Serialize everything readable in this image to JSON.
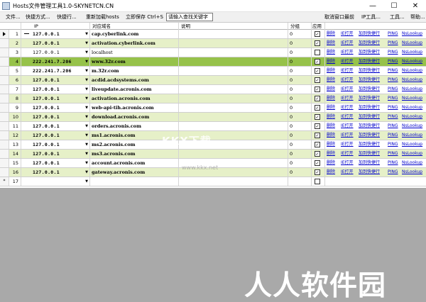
{
  "window": {
    "title": "Hosts文件管理工具1.0-SKYNETCN.CN"
  },
  "menu": {
    "file": "文件...",
    "quick_method": "快捷方式...",
    "quick_run": "快捷行...",
    "reload": "重新加载hosts",
    "save": "立即保存 Ctrl+S",
    "search_placeholder": "请输入查找关键字",
    "cancel_top": "取消窗口最前",
    "ip_tools": "IP工具...",
    "tools": "工具...",
    "help": "帮助..."
  },
  "columns": {
    "ip": "IP",
    "domain": "对应域名",
    "desc": "说明",
    "group": "分组",
    "apply": "应用"
  },
  "links": {
    "delete": "删除",
    "open": "IE打开",
    "add_quick": "加到快捷行",
    "ping": "PING",
    "nslookup": "NsLookup"
  },
  "rows": [
    {
      "num": "1",
      "ip": "127.0.0.1",
      "domain": "cap.cyberlink.com",
      "group": "0",
      "checked": "✓"
    },
    {
      "num": "2",
      "ip": "127.0.0.1",
      "domain": "activation.cyberlink.com",
      "group": "0",
      "checked": "✓"
    },
    {
      "num": "3",
      "ip": "127.0.0.1",
      "domain": "localhost",
      "group": "0",
      "checked": ""
    },
    {
      "num": "4",
      "ip": "222.241.7.206",
      "domain": "www.32r.com",
      "group": "0",
      "checked": "✓"
    },
    {
      "num": "5",
      "ip": "222.241.7.206",
      "domain": "m.32r.com",
      "group": "0",
      "checked": "✓"
    },
    {
      "num": "6",
      "ip": "127.0.0.1",
      "domain": "acdid.acdsystems.com",
      "group": "0",
      "checked": "✓"
    },
    {
      "num": "7",
      "ip": "127.0.0.1",
      "domain": "liveupdate.acronis.com",
      "group": "0",
      "checked": "✓"
    },
    {
      "num": "8",
      "ip": "127.0.0.1",
      "domain": "activation.acronis.com",
      "group": "0",
      "checked": "✓"
    },
    {
      "num": "9",
      "ip": "127.0.0.1",
      "domain": "web-api-tih.acronis.com",
      "group": "0",
      "checked": "✓"
    },
    {
      "num": "10",
      "ip": "127.0.0.1",
      "domain": "download.acronis.com",
      "group": "0",
      "checked": "✓"
    },
    {
      "num": "11",
      "ip": "127.0.0.1",
      "domain": "orders.acronis.com",
      "group": "0",
      "checked": "✓"
    },
    {
      "num": "12",
      "ip": "127.0.0.1",
      "domain": "ms1.acronis.com",
      "group": "0",
      "checked": "✓"
    },
    {
      "num": "13",
      "ip": "127.0.0.1",
      "domain": "ms2.acronis.com",
      "group": "0",
      "checked": "✓"
    },
    {
      "num": "14",
      "ip": "127.0.0.1",
      "domain": "ms3.acronis.com",
      "group": "0",
      "checked": "✓"
    },
    {
      "num": "15",
      "ip": "127.0.0.1",
      "domain": "account.acronis.com",
      "group": "0",
      "checked": "✓"
    },
    {
      "num": "16",
      "ip": "127.0.0.1",
      "domain": "gateway.acronis.com",
      "group": "0",
      "checked": "✓"
    }
  ],
  "newrow": {
    "marker": "*",
    "num": "17"
  },
  "watermark": {
    "text": "KKX下载",
    "url": "www.kkx.net"
  },
  "brand": "人人软件园"
}
